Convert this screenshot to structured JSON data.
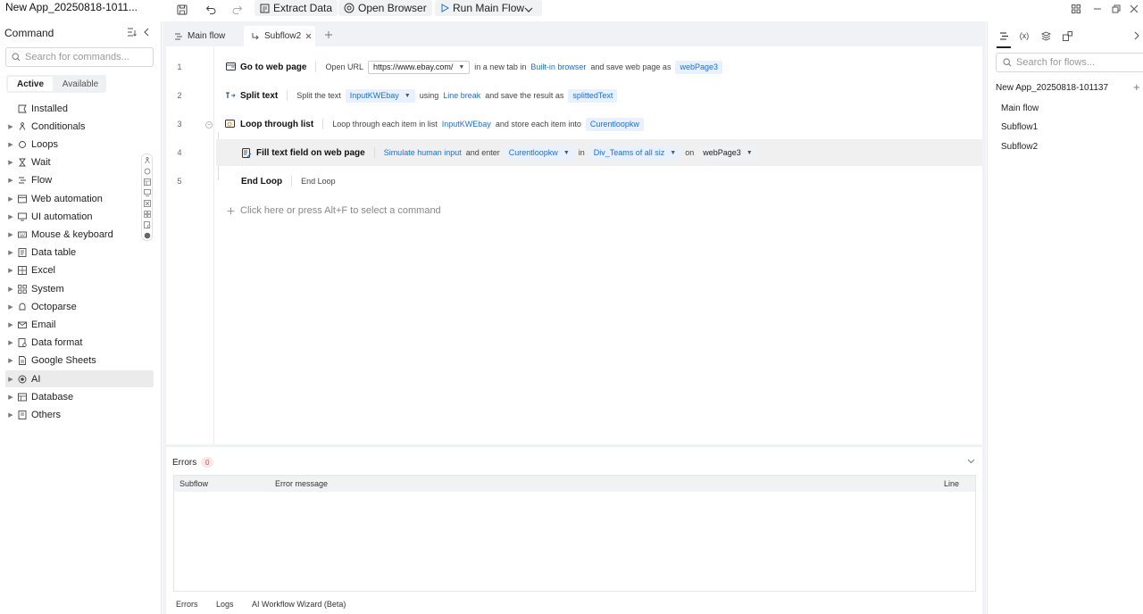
{
  "app": {
    "title": "New App_20250818-1011...",
    "toolbar": {
      "extract_data": "Extract Data",
      "open_browser": "Open Browser",
      "run_main_flow": "Run Main Flow"
    }
  },
  "left_panel": {
    "title": "Command",
    "search_placeholder": "Search for commands...",
    "segments": {
      "active": "Active",
      "available": "Available"
    },
    "categories": [
      {
        "label": "Installed",
        "icon": "installed-icon"
      },
      {
        "label": "Conditionals",
        "icon": "conditionals-icon"
      },
      {
        "label": "Loops",
        "icon": "loops-icon"
      },
      {
        "label": "Wait",
        "icon": "hourglass-icon"
      },
      {
        "label": "Flow",
        "icon": "flow-icon"
      },
      {
        "label": "Web automation",
        "icon": "web-automation-icon"
      },
      {
        "label": "UI automation",
        "icon": "ui-automation-icon"
      },
      {
        "label": "Mouse & keyboard",
        "icon": "mouse-keyboard-icon"
      },
      {
        "label": "Data table",
        "icon": "data-table-icon"
      },
      {
        "label": "Excel",
        "icon": "excel-icon"
      },
      {
        "label": "System",
        "icon": "system-icon"
      },
      {
        "label": "Octoparse",
        "icon": "octoparse-icon"
      },
      {
        "label": "Email",
        "icon": "email-icon"
      },
      {
        "label": "Data format",
        "icon": "data-format-icon"
      },
      {
        "label": "Google Sheets",
        "icon": "google-sheets-icon"
      },
      {
        "label": "AI",
        "icon": "ai-icon"
      },
      {
        "label": "Database",
        "icon": "database-icon"
      },
      {
        "label": "Others",
        "icon": "others-icon"
      }
    ],
    "selected_category": "AI"
  },
  "tabs": [
    {
      "label": "Main flow",
      "active": false
    },
    {
      "label": "Subflow2",
      "active": true
    }
  ],
  "steps": [
    {
      "line": "1",
      "name": "Go to web page",
      "action": "Open URL",
      "url": "https://www.ebay.com/",
      "text_a": "in a new tab in",
      "browser": "Built-in browser",
      "text_b": "and save web page as",
      "var": "webPage3"
    },
    {
      "line": "2",
      "name": "Split text",
      "action": "Split the text",
      "input": "InputKWEbay",
      "text_a": "using",
      "delim": "Line break",
      "text_b": "and save the result as",
      "var": "splittedText"
    },
    {
      "line": "3",
      "name": "Loop through list",
      "action": "Loop through each item in list",
      "list": "InputKWEbay",
      "text_a": "and store each item into",
      "var": "Curentloopkw"
    },
    {
      "line": "4",
      "name": "Fill text field on web page",
      "mode": "Simulate human input",
      "text_a": "and enter",
      "value": "Curentloopkw",
      "text_b": "in",
      "element": "Div_Teams of all siz",
      "text_c": "on",
      "page": "webPage3"
    },
    {
      "line": "5",
      "name": "End Loop",
      "action": "End Loop"
    }
  ],
  "add_command_hint": "Click here or press Alt+F to select a command",
  "errors_panel": {
    "title": "Errors",
    "count": "0",
    "columns": {
      "subflow": "Subflow",
      "message": "Error message",
      "line": "Line"
    },
    "bottom_tabs": [
      "Errors",
      "Logs",
      "AI Workflow Wizard (Beta)"
    ]
  },
  "right_panel": {
    "search_placeholder": "Search for flows...",
    "project": "New App_20250818-101137",
    "flows": [
      "Main flow",
      "Subflow1",
      "Subflow2"
    ],
    "var_tab_label": "(x)"
  }
}
